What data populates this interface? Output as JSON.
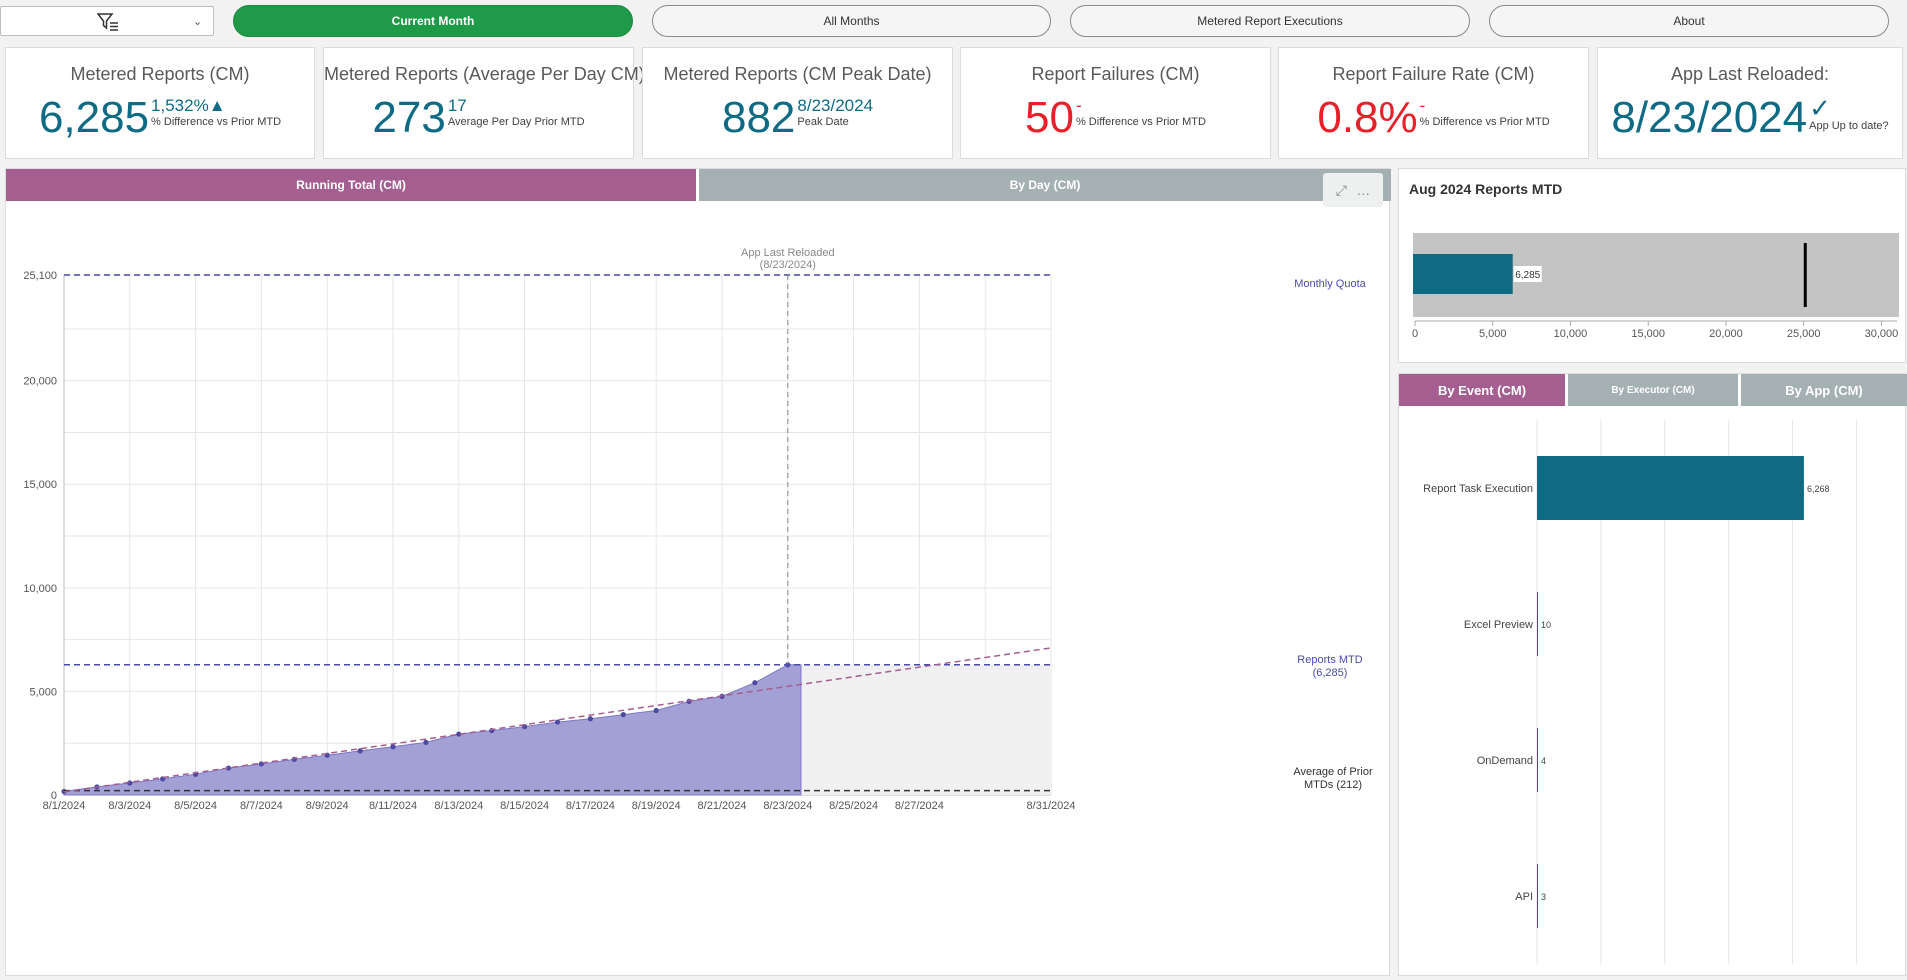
{
  "nav": {
    "filter_icon": "filter-icon",
    "buttons": [
      {
        "label": "Current Month",
        "active": true
      },
      {
        "label": "All Months",
        "active": false
      },
      {
        "label": "Metered Report Executions",
        "active": false
      },
      {
        "label": "About",
        "active": false
      }
    ]
  },
  "kpis": [
    {
      "title": "Metered Reports (CM)",
      "value": "6,285",
      "sub": "1,532%▲",
      "caption": "% Difference vs Prior MTD"
    },
    {
      "title": "Metered Reports (Average Per Day CM)",
      "value": "273",
      "sub": "17",
      "caption": "Average Per Day Prior MTD"
    },
    {
      "title": "Metered Reports (CM Peak Date)",
      "value": "882",
      "sub": "8/23/2024",
      "caption": "Peak Date"
    },
    {
      "title": "Report Failures (CM)",
      "value": "50",
      "sub": "-",
      "caption": "% Difference vs Prior MTD"
    },
    {
      "title": "Report Failure Rate (CM)",
      "value": "0.8%",
      "sub": "-",
      "caption": "% Difference vs Prior MTD"
    },
    {
      "title": "App Last Reloaded:",
      "value": "8/23/2024",
      "sub": "✓",
      "caption": "App Up to date?"
    }
  ],
  "main_tabs": {
    "running_total": "Running Total (CM)",
    "by_day": "By Day (CM)"
  },
  "toolbar": {
    "expand_icon": "expand-icon",
    "more_icon": "more-icon",
    "more_label": "…"
  },
  "colors": {
    "accent_purple": "#a45f90",
    "teal": "#0f6b84",
    "green": "#1f9a48",
    "red": "#e8202a",
    "area": "#a3a0d6",
    "quota_line": "#4a4aa8"
  },
  "chart_data": [
    {
      "type": "area",
      "x_tick_labels": [
        "8/1/2024",
        "8/3/2024",
        "8/5/2024",
        "8/7/2024",
        "8/9/2024",
        "8/11/2024",
        "8/13/2024",
        "8/15/2024",
        "8/17/2024",
        "8/19/2024",
        "8/21/2024",
        "8/23/2024",
        "8/25/2024",
        "8/27/2024",
        "8/31/2024"
      ],
      "y_ticks": [
        "0",
        "5,000",
        "10,000",
        "15,000",
        "20,000",
        "25,100"
      ],
      "ylim": [
        0,
        25100
      ],
      "x_range_days": [
        1,
        31
      ],
      "series": [
        {
          "days": [
            1,
            2,
            3,
            4,
            5,
            6,
            7,
            8,
            9,
            10,
            11,
            12,
            13,
            14,
            15,
            16,
            17,
            18,
            19,
            20,
            21,
            22,
            23
          ],
          "values": [
            170,
            390,
            580,
            780,
            1000,
            1300,
            1500,
            1720,
            1920,
            2130,
            2330,
            2540,
            2940,
            3110,
            3300,
            3520,
            3680,
            3880,
            4080,
            4520,
            4760,
            5420,
            6285
          ]
        }
      ],
      "trend_line": {
        "start_day": 1,
        "start_value": 150,
        "end_day": 31,
        "end_value": 7100
      },
      "monthly_quota": {
        "value": 25100,
        "label": "Monthly Quota"
      },
      "reports_mtd": {
        "value": 6285,
        "label": "Reports MTD",
        "label2": "(6,285)"
      },
      "prior_avg": {
        "value": 212,
        "label": "Average of Prior",
        "label2": "MTDs (212)"
      },
      "reload_marker": {
        "day": 23,
        "label": "App Last Reloaded",
        "label2": "(8/23/2024)"
      },
      "grid": true
    },
    {
      "type": "bar",
      "title": "Aug 2024 Reports MTD",
      "value": 6285,
      "value_label": "6,285",
      "target": 25100,
      "xlim": [
        0,
        31000
      ],
      "x_ticks": [
        "0",
        "5,000",
        "10,000",
        "15,000",
        "20,000",
        "25,000",
        "30,000"
      ]
    },
    {
      "type": "bar",
      "orientation": "horizontal",
      "categories": [
        "Report Task Execution",
        "Excel Preview",
        "OnDemand",
        "API"
      ],
      "values": [
        6268,
        10,
        4,
        3
      ],
      "value_labels": [
        "6,268",
        "10",
        "4",
        "3"
      ],
      "xlim": [
        0,
        8500
      ]
    }
  ],
  "side_tabs": {
    "by_event": "By Event (CM)",
    "by_executor": "By Executor (CM)",
    "by_app": "By App (CM)"
  }
}
